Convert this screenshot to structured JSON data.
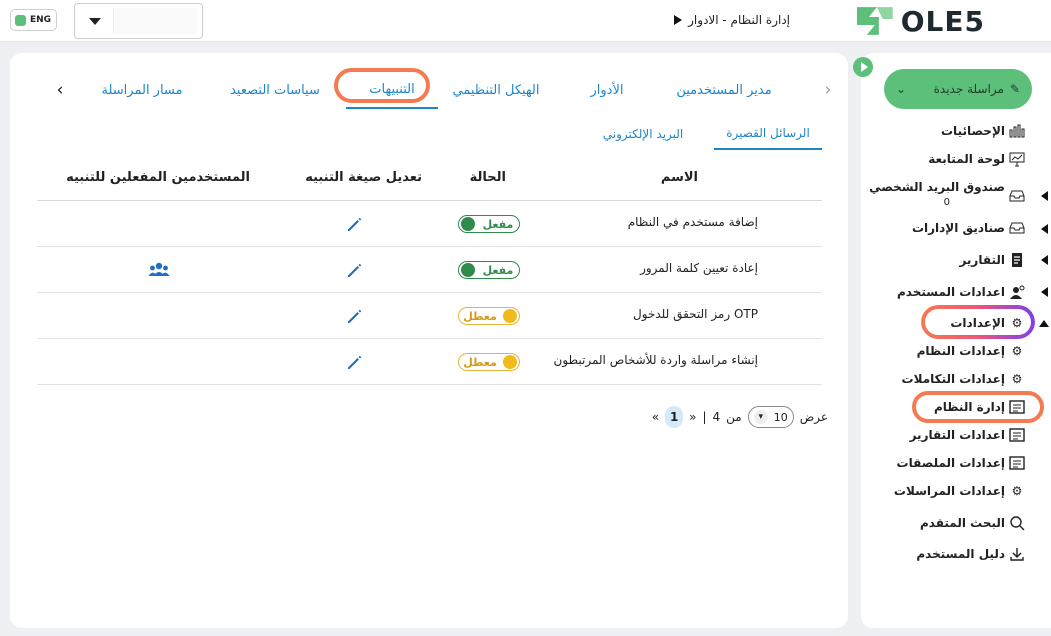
{
  "topbar": {
    "language": "ENG",
    "breadcrumb": "إدارة النظام - الادوار",
    "logo_text": "OLE5"
  },
  "tabs": {
    "items": [
      {
        "label": "مدير المستخدمين"
      },
      {
        "label": "الأدوار"
      },
      {
        "label": "الهيكل التنظيمي"
      },
      {
        "label": "التنبيهات"
      },
      {
        "label": "سياسات التصعيد"
      },
      {
        "label": "مسار المراسلة"
      }
    ],
    "active_index": 3
  },
  "subtabs": {
    "items": [
      {
        "label": "الرسائل القصيرة"
      },
      {
        "label": "البريد الإلكتروني"
      }
    ],
    "active_index": 0
  },
  "table": {
    "headers": {
      "name": "الاسم",
      "status": "الحالة",
      "edit_template": "تعديل صيغة التنبيه",
      "enabled_users": "المستخدمين المفعلين للتنبيه"
    },
    "rows": [
      {
        "name": "إضافة مستخدم في النظام",
        "status": "مفعل",
        "status_on": true,
        "has_users": false
      },
      {
        "name": "إعادة تعيين كلمة المرور",
        "status": "مفعل",
        "status_on": true,
        "has_users": true
      },
      {
        "name": "OTP رمز التحقق للدخول",
        "status": "معطل",
        "status_on": false,
        "has_users": false
      },
      {
        "name": "إنشاء مراسلة واردة للأشخاص المرتبطون",
        "status": "معطل",
        "status_on": false,
        "has_users": false
      }
    ]
  },
  "pagination": {
    "show_label": "عرض",
    "page_size": "10",
    "of_label": "من",
    "total_pages": "4",
    "separator": "|",
    "first": "«",
    "current_page": "1",
    "last": "»"
  },
  "sidebar": {
    "new_message_label": "مراسلة جديدة",
    "items": [
      {
        "label": "الإحصائيات",
        "icon": "bar-chart-icon"
      },
      {
        "label": "لوحة المتابعة",
        "icon": "monitor-icon"
      },
      {
        "label": "صندوق البريد الشخصي",
        "sub": "0",
        "icon": "inbox-icon"
      },
      {
        "label": "صناديق الإدارات",
        "icon": "inbox-icon"
      },
      {
        "label": "التقارير",
        "icon": "report-icon"
      },
      {
        "label": "اعدادات المستخدم",
        "icon": "user-gear-icon"
      },
      {
        "label": "الإعدادات",
        "icon": "gear-icon"
      },
      {
        "label": "إعدادات النظام",
        "icon": "gear-icon"
      },
      {
        "label": "إعدادات التكاملات",
        "icon": "gear-icon"
      },
      {
        "label": "إدارة النظام",
        "icon": "list-icon"
      },
      {
        "label": "اعدادات التقارير",
        "icon": "list-icon"
      },
      {
        "label": "إعدادات الملصقات",
        "icon": "list-icon"
      },
      {
        "label": "إعدادات المراسلات",
        "icon": "gear-icon"
      },
      {
        "label": "البحث المتقدم",
        "icon": "search-icon"
      },
      {
        "label": "دليل المستخدم",
        "icon": "download-icon"
      }
    ]
  },
  "colors": {
    "accent": "#1e86c8",
    "brand_green": "#5cc07a",
    "highlight": "#f47a52",
    "enabled": "#2e8b4b",
    "disabled": "#f2bb1c"
  }
}
